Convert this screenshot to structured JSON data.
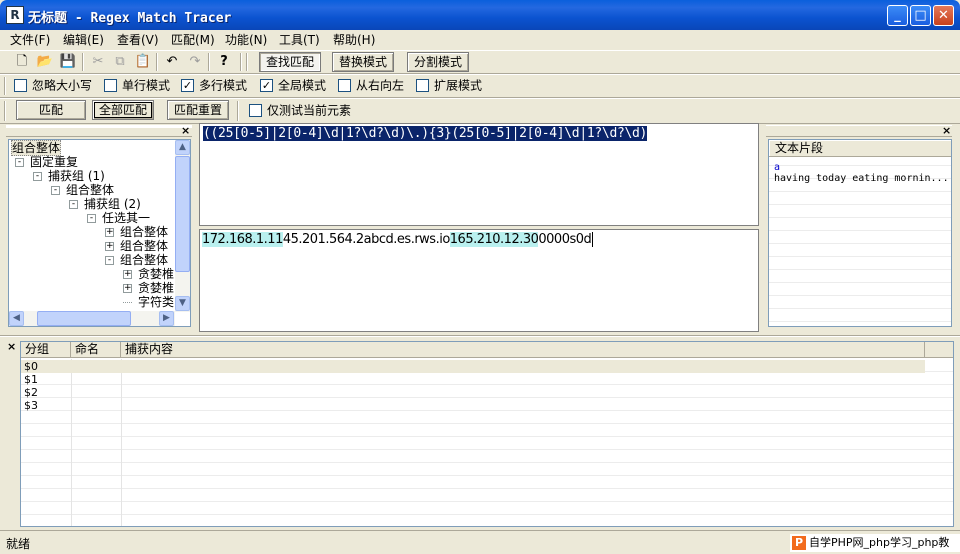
{
  "window": {
    "title": "无标题 - Regex Match Tracer",
    "icon_name": "app-icon",
    "minimize": "_",
    "maximize": "□",
    "close": "✕"
  },
  "menu": [
    "文件(F)",
    "编辑(E)",
    "查看(V)",
    "匹配(M)",
    "功能(N)",
    "工具(T)",
    "帮助(H)"
  ],
  "toolbar1": {
    "icons": [
      "new-file-icon",
      "open-folder-icon",
      "save-icon",
      "cut-icon",
      "copy-icon",
      "paste-icon",
      "undo-icon",
      "redo-icon",
      "help-icon"
    ],
    "mode_buttons": [
      "查找匹配",
      "替换模式",
      "分割模式"
    ]
  },
  "options": [
    {
      "label": "忽略大小写",
      "checked": false
    },
    {
      "label": "单行模式",
      "checked": false
    },
    {
      "label": "多行模式",
      "checked": true
    },
    {
      "label": "全局模式",
      "checked": true
    },
    {
      "label": "从右向左",
      "checked": false
    },
    {
      "label": "扩展模式",
      "checked": false
    }
  ],
  "toolbar3": {
    "match": "匹配",
    "match_all": "全部匹配",
    "match_reset": "匹配重置",
    "test_current_label": "仅测试当前元素",
    "test_current_checked": false
  },
  "tree": {
    "close": "×",
    "items": [
      {
        "label": "组合整体",
        "level": 0,
        "expander": "",
        "selected": true
      },
      {
        "label": "固定重复",
        "level": 0,
        "expander": "-"
      },
      {
        "label": "捕获组 (1)",
        "level": 1,
        "expander": "-"
      },
      {
        "label": "组合整体",
        "level": 2,
        "expander": "-"
      },
      {
        "label": "捕获组 (2)",
        "level": 3,
        "expander": "-"
      },
      {
        "label": "任选其一",
        "level": 4,
        "expander": "-"
      },
      {
        "label": "组合整体",
        "level": 5,
        "expander": "+"
      },
      {
        "label": "组合整体",
        "level": 5,
        "expander": "+"
      },
      {
        "label": "组合整体",
        "level": 5,
        "expander": "-"
      },
      {
        "label": "贪婪椎",
        "level": 6,
        "expander": "+"
      },
      {
        "label": "贪婪椎",
        "level": 6,
        "expander": "+"
      },
      {
        "label": "字符类",
        "level": 6,
        "expander": ""
      }
    ]
  },
  "regex": "((25[0-5]|2[0-4]\\d|1?\\d?\\d)\\.){3}(25[0-5]|2[0-4]\\d|1?\\d?\\d)",
  "test_text": {
    "seg1": "172.168.1.11",
    "seg2": "45.201.564.2abcd.es.rws.io",
    "seg3": "165.210.12.30",
    "seg4": "0000s0d"
  },
  "snippets": {
    "close": "×",
    "header": "文本片段",
    "items": [
      "a",
      "having today eating mornin..."
    ]
  },
  "groups": {
    "close": "×",
    "columns": [
      "分组",
      "命名",
      "捕获内容"
    ],
    "rows": [
      "$0",
      "$1",
      "$2",
      "$3"
    ]
  },
  "status": {
    "text": "就绪",
    "watermark": "自学PHP网_php学习_php教"
  }
}
